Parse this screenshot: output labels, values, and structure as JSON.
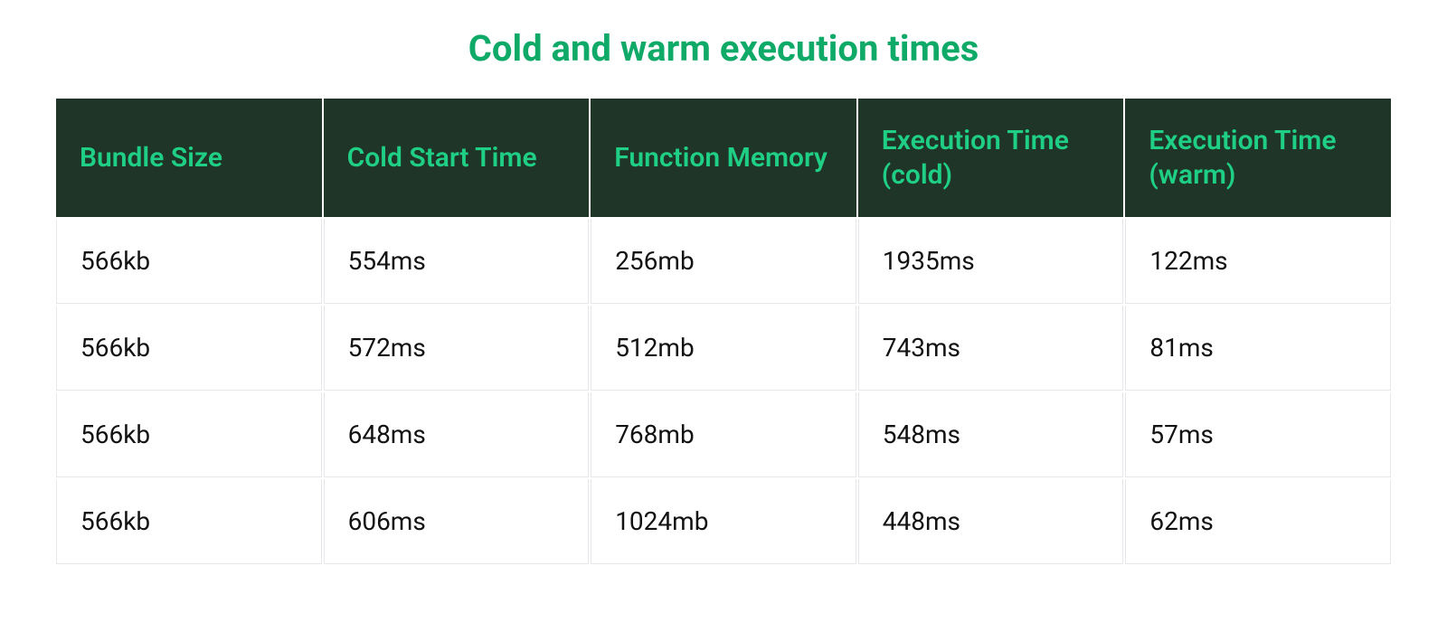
{
  "title": "Cold and warm execution times",
  "columns": [
    "Bundle Size",
    "Cold Start Time",
    "Function Memory",
    "Execution Time (cold)",
    "Execution Time (warm)"
  ],
  "rows": [
    {
      "bundle_size": "566kb",
      "cold_start_time": "554ms",
      "function_memory": "256mb",
      "execution_time_cold": "1935ms",
      "execution_time_warm": "122ms"
    },
    {
      "bundle_size": "566kb",
      "cold_start_time": "572ms",
      "function_memory": "512mb",
      "execution_time_cold": "743ms",
      "execution_time_warm": "81ms"
    },
    {
      "bundle_size": "566kb",
      "cold_start_time": "648ms",
      "function_memory": "768mb",
      "execution_time_cold": "548ms",
      "execution_time_warm": "57ms"
    },
    {
      "bundle_size": "566kb",
      "cold_start_time": "606ms",
      "function_memory": "1024mb",
      "execution_time_cold": "448ms",
      "execution_time_warm": "62ms"
    }
  ],
  "chart_data": {
    "type": "table",
    "title": "Cold and warm execution times",
    "columns": [
      "Bundle Size",
      "Cold Start Time",
      "Function Memory",
      "Execution Time (cold)",
      "Execution Time (warm)"
    ],
    "rows": [
      [
        "566kb",
        "554ms",
        "256mb",
        "1935ms",
        "122ms"
      ],
      [
        "566kb",
        "572ms",
        "512mb",
        "743ms",
        "81ms"
      ],
      [
        "566kb",
        "648ms",
        "768mb",
        "548ms",
        "57ms"
      ],
      [
        "566kb",
        "606ms",
        "1024mb",
        "448ms",
        "62ms"
      ]
    ]
  }
}
